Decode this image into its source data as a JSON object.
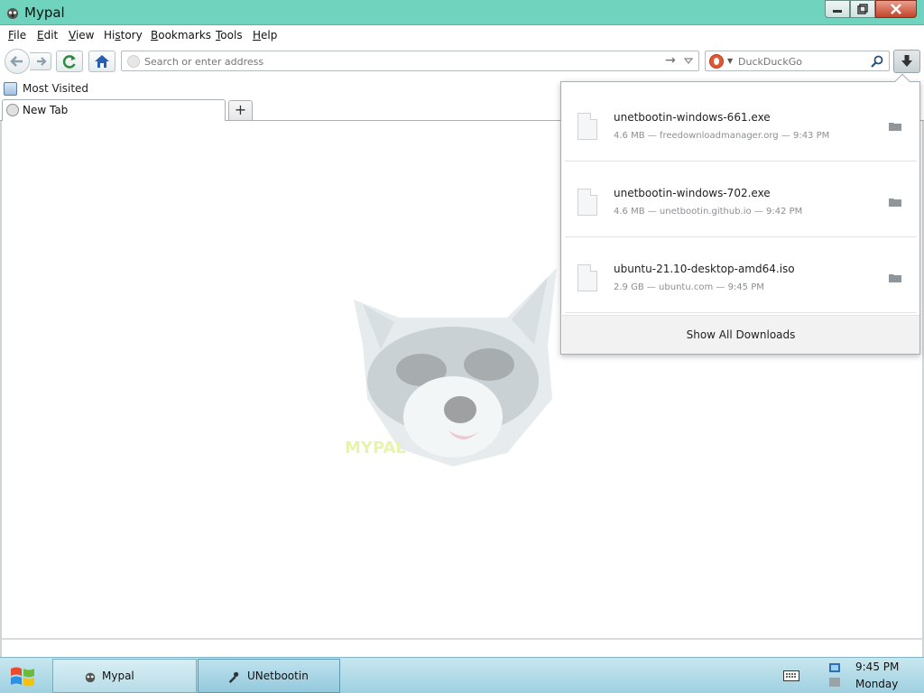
{
  "window": {
    "title": "Mypal"
  },
  "menu": [
    {
      "key": "F",
      "rest": "ile"
    },
    {
      "key": "E",
      "rest": "dit"
    },
    {
      "key": "V",
      "rest": "iew"
    },
    {
      "key": "",
      "pre": "Hi",
      "keyMid": "s",
      "rest": "tory"
    },
    {
      "key": "B",
      "rest": "ookmarks"
    },
    {
      "key": "T",
      "rest": "ools"
    },
    {
      "key": "H",
      "rest": "elp"
    }
  ],
  "menu_labels": [
    "File",
    "Edit",
    "View",
    "History",
    "Bookmarks",
    "Tools",
    "Help"
  ],
  "urlbar": {
    "placeholder": "Search or enter address"
  },
  "searchbar": {
    "placeholder": "DuckDuckGo"
  },
  "bookmarks": {
    "most_visited": "Most Visited"
  },
  "tabs": [
    {
      "label": "New Tab"
    }
  ],
  "downloads": {
    "items": [
      {
        "name": "unetbootin-windows-661.exe",
        "meta": "4.6 MB — freedownloadmanager.org — 9:43 PM"
      },
      {
        "name": "unetbootin-windows-702.exe",
        "meta": "4.6 MB — unetbootin.github.io — 9:42 PM"
      },
      {
        "name": "ubuntu-21.10-desktop-amd64.iso",
        "meta": "2.9 GB — ubuntu.com — 9:45 PM"
      }
    ],
    "show_all": "Show All Downloads"
  },
  "taskbar": {
    "apps": [
      {
        "label": "Mypal"
      },
      {
        "label": "UNetbootin"
      }
    ],
    "clock": {
      "time": "9:45 PM",
      "day": "Monday"
    }
  },
  "colors": {
    "titlebar": "#6fd3be",
    "taskbar": "#b7dce8",
    "ddg": "#de5833"
  }
}
